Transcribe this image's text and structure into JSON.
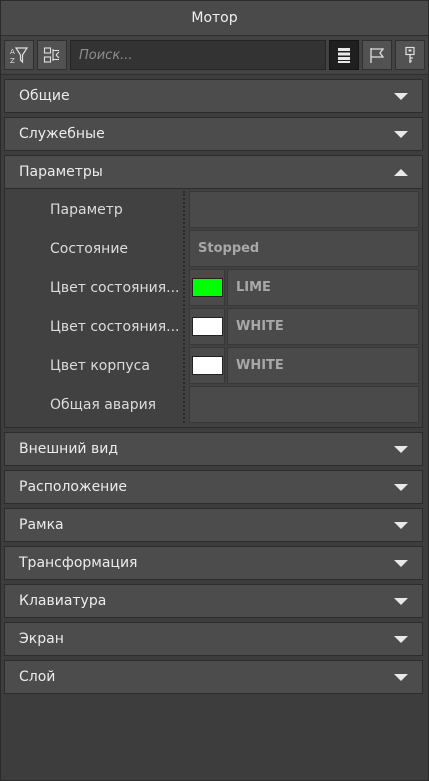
{
  "title": "Мотор",
  "search": {
    "placeholder": "Поиск..."
  },
  "toolbar": {
    "buttons": [
      {
        "icon": "sort-filter-icon"
      },
      {
        "icon": "collapse-icon"
      },
      {
        "icon": "list-view-icon",
        "active": true
      },
      {
        "icon": "flag-icon"
      },
      {
        "icon": "key-icon"
      }
    ]
  },
  "sections": {
    "general": "Общие",
    "service": "Служебные",
    "params": "Параметры",
    "appearance": "Внешний вид",
    "position": "Расположение",
    "frame": "Рамка",
    "transform": "Трансформация",
    "keyboard": "Клавиатура",
    "screen": "Экран",
    "layer": "Слой"
  },
  "params": {
    "parameter": {
      "label": "Параметр",
      "value": ""
    },
    "state": {
      "label": "Состояние",
      "value": "Stopped"
    },
    "state_color_1": {
      "label": "Цвет состояния...",
      "color": "#00ff00",
      "value": "LIME"
    },
    "state_color_2": {
      "label": "Цвет состояния...",
      "color": "#ffffff",
      "value": "WHITE"
    },
    "body_color": {
      "label": "Цвет корпуса",
      "color": "#ffffff",
      "value": "WHITE"
    },
    "alarm": {
      "label": "Общая авария",
      "value": ""
    }
  }
}
